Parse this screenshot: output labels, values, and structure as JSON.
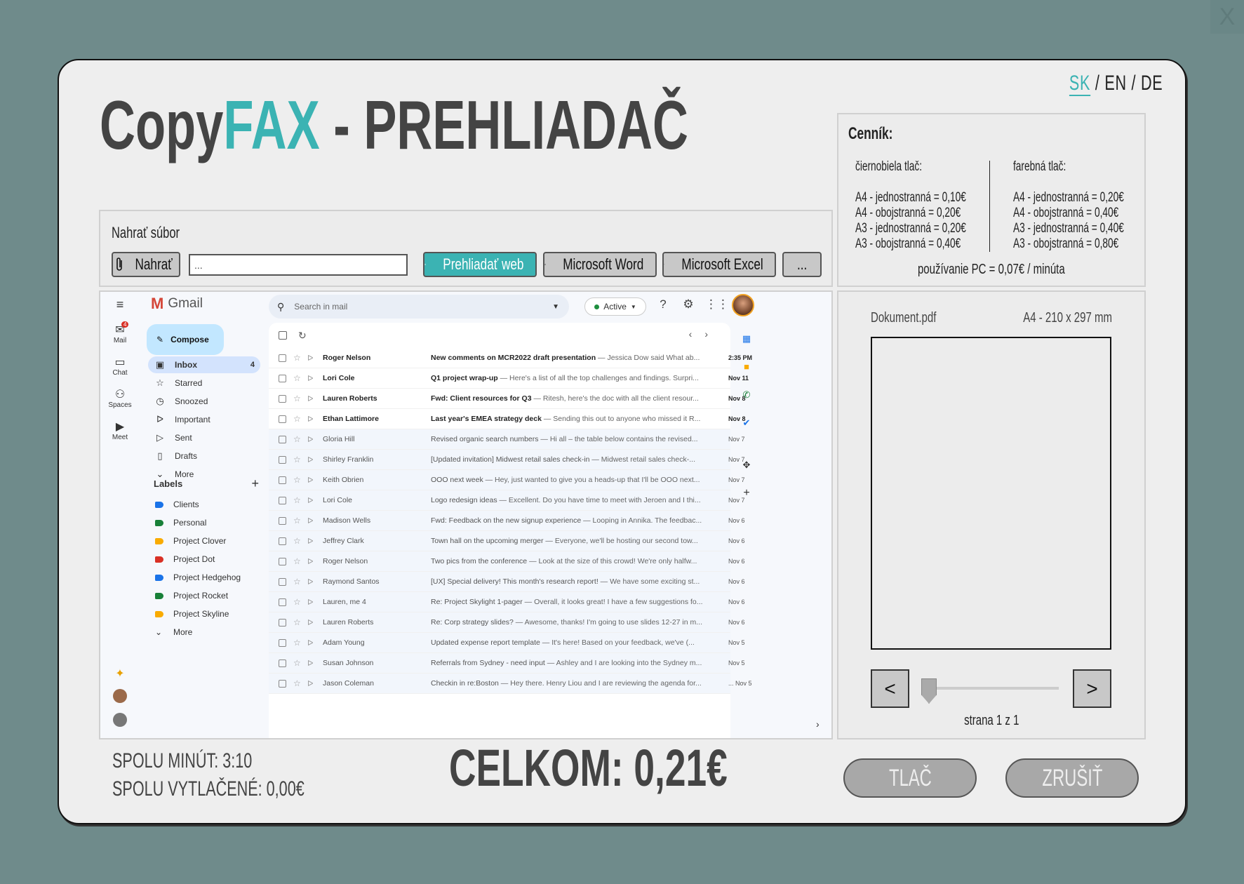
{
  "close_glyph": "X",
  "lang": {
    "sk": "SK",
    "sep1": " / ",
    "en": "EN",
    "sep2": " / ",
    "de": "DE"
  },
  "title": {
    "part1": "Copy",
    "part2": "FAX",
    "part3": " - PREHLIADAČ"
  },
  "upload": {
    "label": "Nahrať súbor",
    "upload_button": "Nahrať",
    "file_value": "...",
    "web_button": "Prehliadať web",
    "word_button": "Microsoft Word",
    "excel_button": "Microsoft Excel",
    "more_button": "..."
  },
  "pricing": {
    "heading": "Cenník:",
    "bw_title": "čiernobiela tlač:",
    "bw": [
      "A4 - jednostranná = 0,10€",
      "A4 - obojstranná = 0,20€",
      "A3 - jednostranná = 0,20€",
      "A3 - obojstranná = 0,40€"
    ],
    "color_title": "farebná tlač:",
    "color": [
      "A4 - jednostranná = 0,20€",
      "A4 - obojstranná = 0,40€",
      "A3 - jednostranná = 0,40€",
      "A3 - obojstranná = 0,80€"
    ],
    "pc_usage": "používanie PC = 0,07€ / minúta"
  },
  "preview": {
    "doc_name": "Dokument.pdf",
    "doc_size": "A4 - 210 x 297 mm",
    "prev": "<",
    "next": ">",
    "page_label": "strana 1 z 1",
    "slider_value": 0
  },
  "gmail": {
    "rail": [
      {
        "icon": "mail-icon",
        "glyph": "✉",
        "label": "Mail",
        "badge": "4"
      },
      {
        "icon": "chat-icon",
        "glyph": "▭",
        "label": "Chat"
      },
      {
        "icon": "spaces-icon",
        "glyph": "⚇",
        "label": "Spaces"
      },
      {
        "icon": "meet-icon",
        "glyph": "▶",
        "label": "Meet"
      }
    ],
    "brand": "Gmail",
    "compose": "Compose",
    "nav": [
      {
        "label": "Inbox",
        "count": "4",
        "icon": "inbox-icon",
        "glyph": "▣"
      },
      {
        "label": "Starred",
        "icon": "star-icon",
        "glyph": "☆"
      },
      {
        "label": "Snoozed",
        "icon": "clock-icon",
        "glyph": "◷"
      },
      {
        "label": "Important",
        "icon": "important-icon",
        "glyph": "ᐅ"
      },
      {
        "label": "Sent",
        "icon": "send-icon",
        "glyph": "▷"
      },
      {
        "label": "Drafts",
        "icon": "draft-icon",
        "glyph": "▯"
      },
      {
        "label": "More",
        "icon": "chevron-down-icon",
        "glyph": "⌄"
      }
    ],
    "labels_heading": "Labels",
    "labels": [
      {
        "label": "Clients",
        "color": "#1a73e8"
      },
      {
        "label": "Personal",
        "color": "#188038"
      },
      {
        "label": "Project Clover",
        "color": "#f9ab00"
      },
      {
        "label": "Project Dot",
        "color": "#d93025"
      },
      {
        "label": "Project Hedgehog",
        "color": "#1a73e8"
      },
      {
        "label": "Project Rocket",
        "color": "#188038"
      },
      {
        "label": "Project Skyline",
        "color": "#f9ab00"
      }
    ],
    "labels_more": "More",
    "search_placeholder": "Search in mail",
    "status": "Active",
    "emails": [
      {
        "from": "Roger Nelson",
        "subject": "New comments on MCR2022 draft presentation",
        "snippet": " — Jessica Dow said What ab...",
        "date": "2:35 PM",
        "unread": true
      },
      {
        "from": "Lori Cole",
        "subject": "Q1 project wrap-up",
        "snippet": " — Here's a list of all the top challenges and findings. Surpri...",
        "date": "Nov 11",
        "unread": true
      },
      {
        "from": "Lauren Roberts",
        "subject": "Fwd: Client resources for Q3",
        "snippet": " — Ritesh, here's the doc with all the client resour...",
        "date": "Nov 8",
        "unread": true
      },
      {
        "from": "Ethan Lattimore",
        "subject": "Last year's EMEA strategy deck",
        "snippet": " — Sending this out to anyone who missed it R...",
        "date": "Nov 8",
        "unread": true
      },
      {
        "from": "Gloria Hill",
        "subject": "Revised organic search numbers",
        "snippet": " — Hi all – the table below contains the revised...",
        "date": "Nov 7",
        "unread": false
      },
      {
        "from": "Shirley Franklin",
        "subject": "[Updated invitation] Midwest retail sales check-in",
        "snippet": " — Midwest retail sales check-...",
        "date": "Nov 7",
        "unread": false
      },
      {
        "from": "Keith Obrien",
        "subject": "OOO next week",
        "snippet": " — Hey, just wanted to give you a heads-up that I'll be OOO next...",
        "date": "Nov 7",
        "unread": false
      },
      {
        "from": "Lori Cole",
        "subject": "Logo redesign ideas",
        "snippet": " — Excellent. Do you have time to meet with Jeroen and I thi...",
        "date": "Nov 7",
        "unread": false
      },
      {
        "from": "Madison Wells",
        "subject": "Fwd: Feedback on the new signup experience",
        "snippet": " — Looping in Annika. The feedbac...",
        "date": "Nov 6",
        "unread": false
      },
      {
        "from": "Jeffrey Clark",
        "subject": "Town hall on the upcoming merger",
        "snippet": " — Everyone, we'll be hosting our second tow...",
        "date": "Nov 6",
        "unread": false
      },
      {
        "from": "Roger Nelson",
        "subject": "Two pics from the conference",
        "snippet": " — Look at the size of this crowd! We're only halfw...",
        "date": "Nov 6",
        "unread": false
      },
      {
        "from": "Raymond Santos",
        "subject": "[UX] Special delivery! This month's research report!",
        "snippet": " — We have some exciting st...",
        "date": "Nov 6",
        "unread": false
      },
      {
        "from": "Lauren, me  4",
        "subject": "Re: Project Skylight 1-pager",
        "snippet": " — Overall, it looks great! I have a few suggestions fo...",
        "date": "Nov 6",
        "unread": false
      },
      {
        "from": "Lauren Roberts",
        "subject": "Re: Corp strategy slides?",
        "snippet": " — Awesome, thanks! I'm going to use slides 12-27 in m...",
        "date": "Nov 6",
        "unread": false
      },
      {
        "from": "Adam Young",
        "subject": "Updated expense report template",
        "snippet": " — It's here! Based on your feedback, we've (...",
        "date": "Nov 5",
        "unread": false
      },
      {
        "from": "Susan Johnson",
        "subject": "Referrals from Sydney - need input",
        "snippet": " — Ashley and I are looking into the Sydney m...",
        "date": "Nov 5",
        "unread": false
      },
      {
        "from": "Jason Coleman",
        "subject": "Checkin in re:Boston",
        "snippet": " — Hey there. Henry Liou and I are reviewing the agenda for...",
        "date": "... Nov 5",
        "unread": false
      }
    ]
  },
  "footer": {
    "minutes": "SPOLU MINÚT: 3:10",
    "printed": "SPOLU VYTLAČENÉ: 0,00€",
    "total": "CELKOM: 0,21€",
    "print_button": "TLAČ",
    "cancel_button": "ZRUŠIŤ"
  }
}
